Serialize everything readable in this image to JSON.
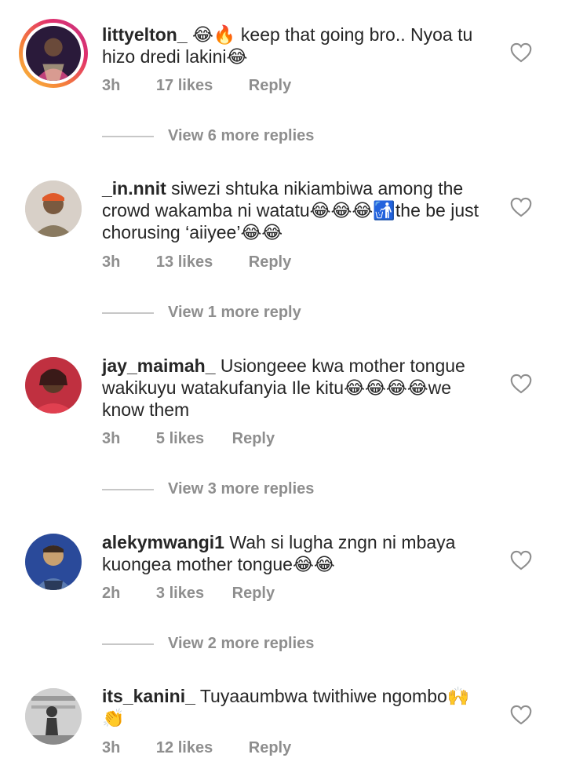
{
  "comments": [
    {
      "username": "littyelton_",
      "text_parts": [
        " ",
        "😂",
        "🔥",
        " keep that going bro.. Nyoa tu hizo dredi lakini",
        "😂"
      ],
      "time": "3h",
      "likes": "17 likes",
      "reply": "Reply",
      "view_more": "View 6 more replies",
      "avatar_colors": {
        "bg": "#2a1a3a",
        "accent": "#c0407a"
      }
    },
    {
      "username": "_in.nnit",
      "text_parts": [
        " siwezi shtuka nikiambiwa among the crowd wakamba ni watatu",
        "😂😂😂",
        "🚮",
        "the be just chorusing ‘aiiyee’",
        "😂😂"
      ],
      "time": "3h",
      "likes": "13 likes",
      "reply": "Reply",
      "view_more": "View 1 more reply",
      "avatar_colors": {
        "bg": "#d8d0c8",
        "accent": "#e05a2a"
      }
    },
    {
      "username": "jay_maimah_",
      "text_parts": [
        " Usiongeee kwa mother tongue wakikuyu watakufanyia Ile kitu",
        "😂😂😂😂",
        "we know them"
      ],
      "time": "3h",
      "likes": "5 likes",
      "reply": "Reply",
      "view_more": "View 3 more replies",
      "avatar_colors": {
        "bg": "#c03040",
        "accent": "#3a1a18"
      }
    },
    {
      "username": "alekymwangi1",
      "text_parts": [
        " Wah si lugha zngn ni mbaya kuongea mother tongue",
        "😂😂"
      ],
      "time": "2h",
      "likes": "3 likes",
      "reply": "Reply",
      "view_more": "View 2 more replies",
      "avatar_colors": {
        "bg": "#2a4a9a",
        "accent": "#c8a070"
      }
    },
    {
      "username": "its_kanini_",
      "text_parts": [
        " Tuyaaumbwa twithiwe ngombo",
        "🙌",
        "👏"
      ],
      "time": "3h",
      "likes": "12 likes",
      "reply": "Reply",
      "view_more": "",
      "avatar_colors": {
        "bg": "#9a9a9a",
        "accent": "#3a3a3a"
      }
    }
  ]
}
